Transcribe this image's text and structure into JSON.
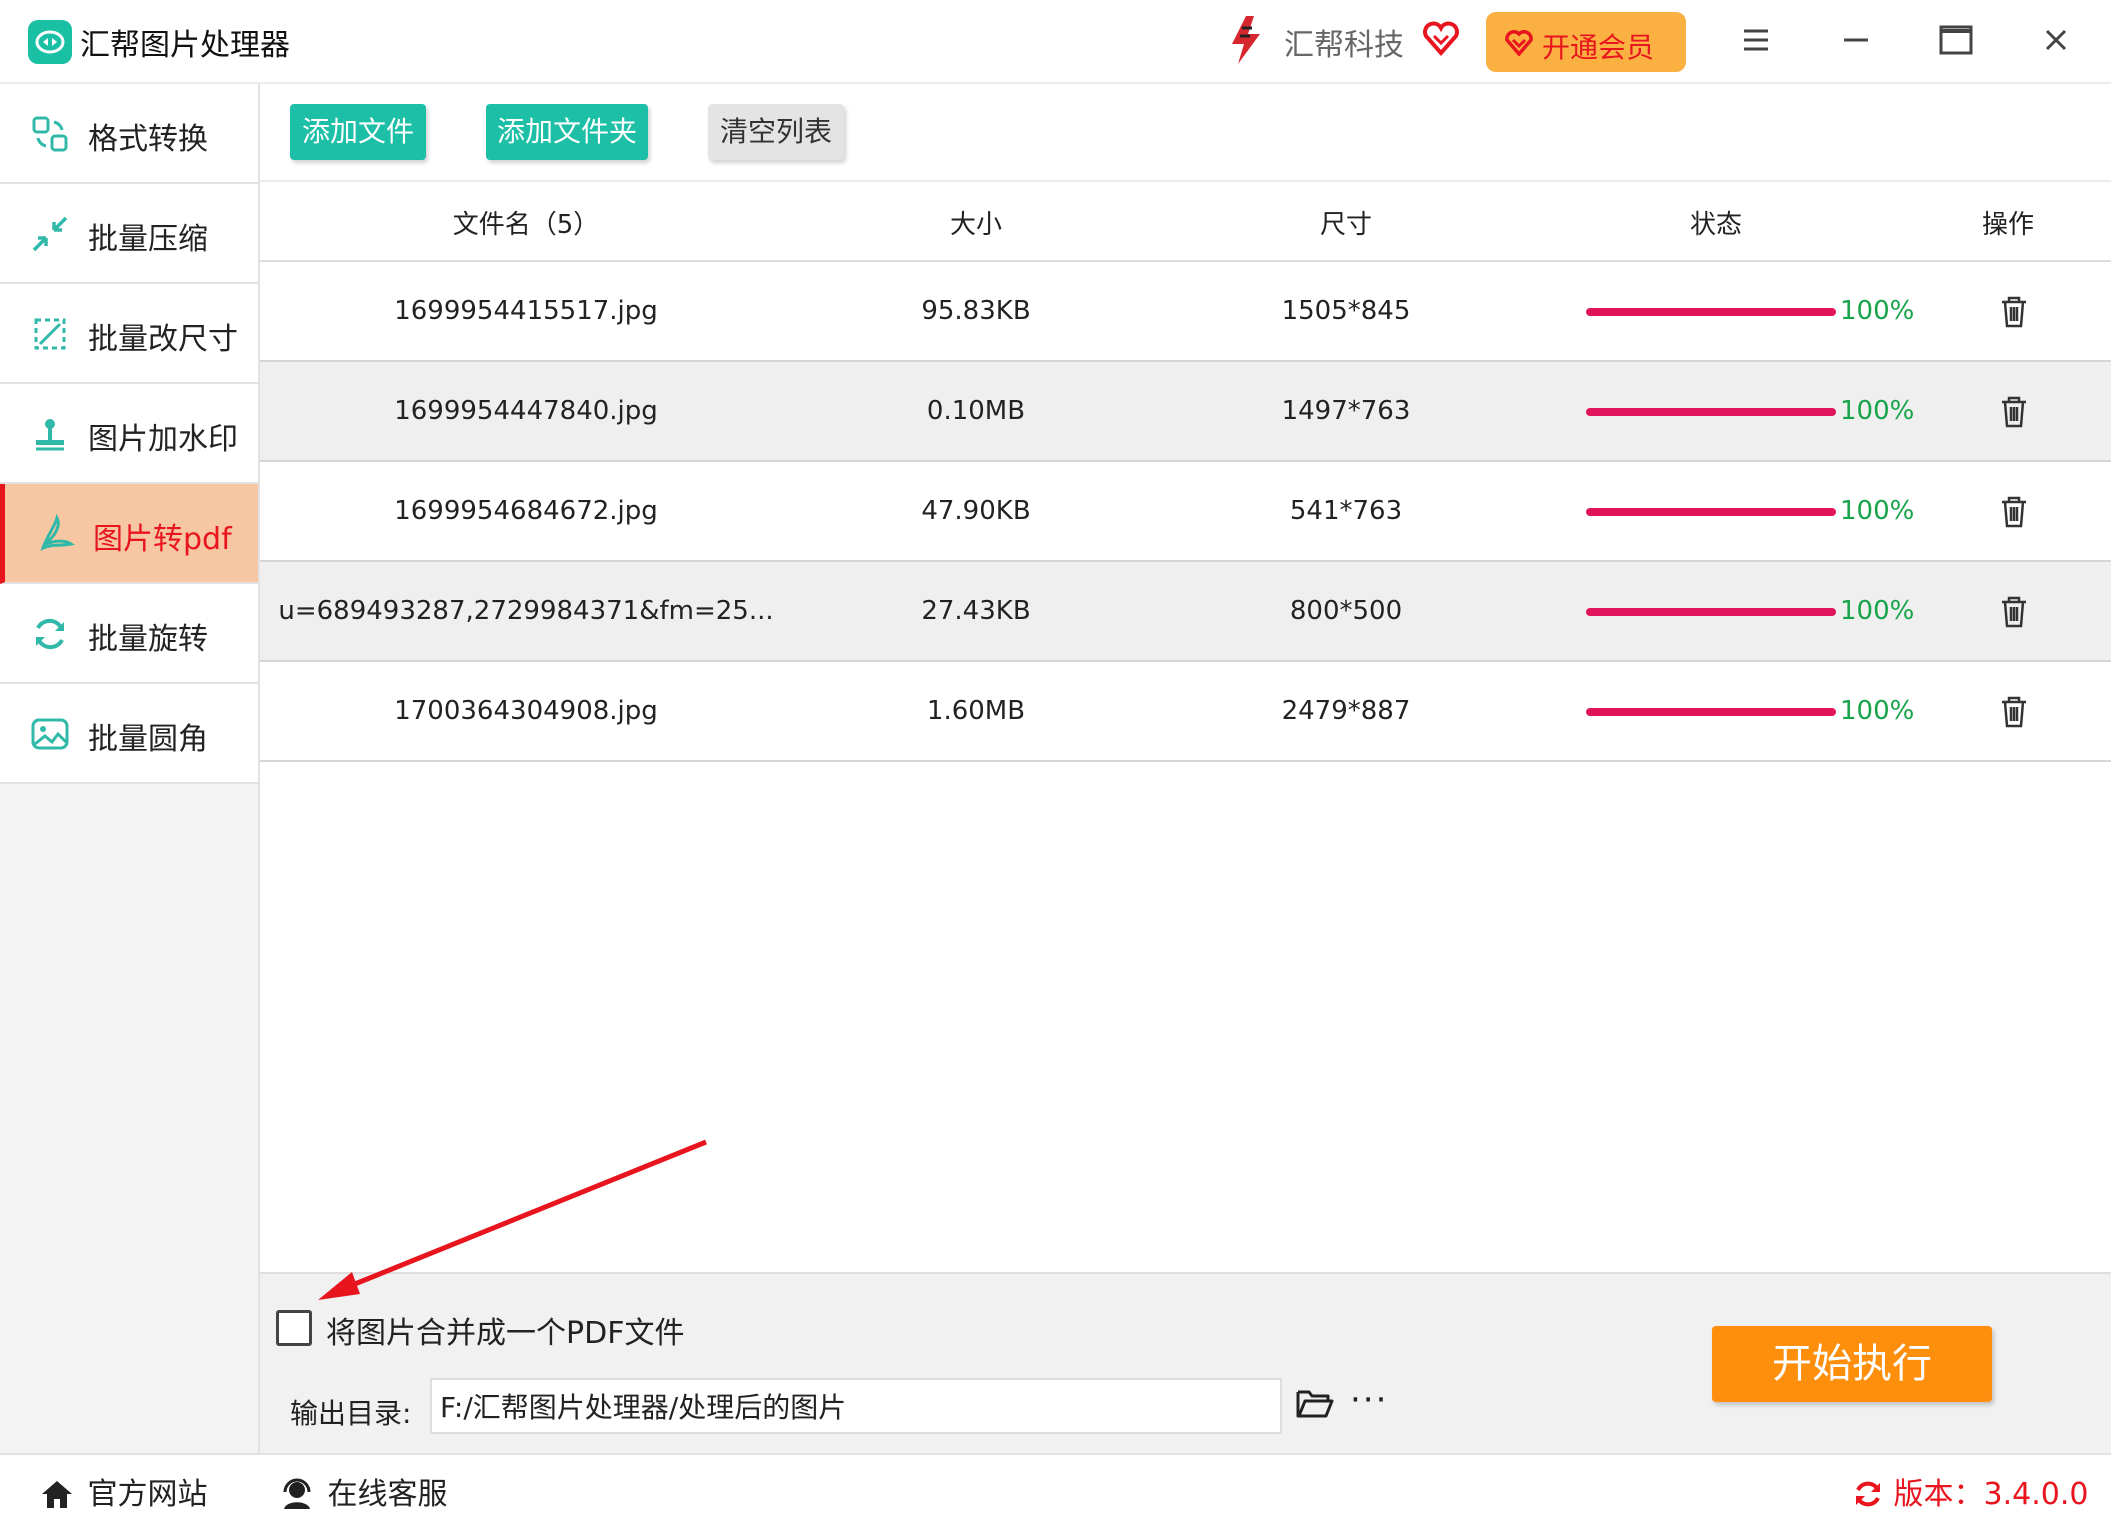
{
  "window": {
    "app_title": "汇帮图片处理器",
    "brand_name": "汇帮科技",
    "vip_label": "开通会员"
  },
  "sidebar": {
    "items": [
      {
        "label": "格式转换",
        "icon": "format-convert-icon"
      },
      {
        "label": "批量压缩",
        "icon": "compress-icon"
      },
      {
        "label": "批量改尺寸",
        "icon": "resize-icon"
      },
      {
        "label": "图片加水印",
        "icon": "watermark-icon"
      },
      {
        "label": "图片转pdf",
        "icon": "pdf-icon",
        "active": true
      },
      {
        "label": "批量旋转",
        "icon": "rotate-icon"
      },
      {
        "label": "批量圆角",
        "icon": "round-corner-icon"
      }
    ]
  },
  "toolbar": {
    "add_file": "添加文件",
    "add_folder": "添加文件夹",
    "clear_list": "清空列表"
  },
  "table": {
    "headers": {
      "filename": "文件名（5）",
      "size": "大小",
      "dimensions": "尺寸",
      "status": "状态",
      "action": "操作"
    },
    "rows": [
      {
        "name": "1699954415517.jpg",
        "size": "95.83KB",
        "dim": "1505*845",
        "progress": "100%"
      },
      {
        "name": "1699954447840.jpg",
        "size": "0.10MB",
        "dim": "1497*763",
        "progress": "100%"
      },
      {
        "name": "1699954684672.jpg",
        "size": "47.90KB",
        "dim": "541*763",
        "progress": "100%"
      },
      {
        "name": "u=689493287,2729984371&fm=25...",
        "size": "27.43KB",
        "dim": "800*500",
        "progress": "100%"
      },
      {
        "name": "1700364304908.jpg",
        "size": "1.60MB",
        "dim": "2479*887",
        "progress": "100%"
      }
    ]
  },
  "bottom": {
    "merge_label": "将图片合并成一个PDF文件",
    "merge_checked": false,
    "output_label": "输出目录:",
    "output_path": "F:/汇帮图片处理器/处理后的图片",
    "more": "···",
    "start_button": "开始执行"
  },
  "footer": {
    "website": "官方网站",
    "support": "在线客服",
    "version": "版本：3.4.0.0"
  },
  "colors": {
    "accent_green": "#1dbfa7",
    "active_red": "#e8141e",
    "progress_bar": "#e0145a",
    "progress_text": "#16a34a",
    "start_orange": "#fd8f0d",
    "vip_orange": "#fbb042"
  }
}
